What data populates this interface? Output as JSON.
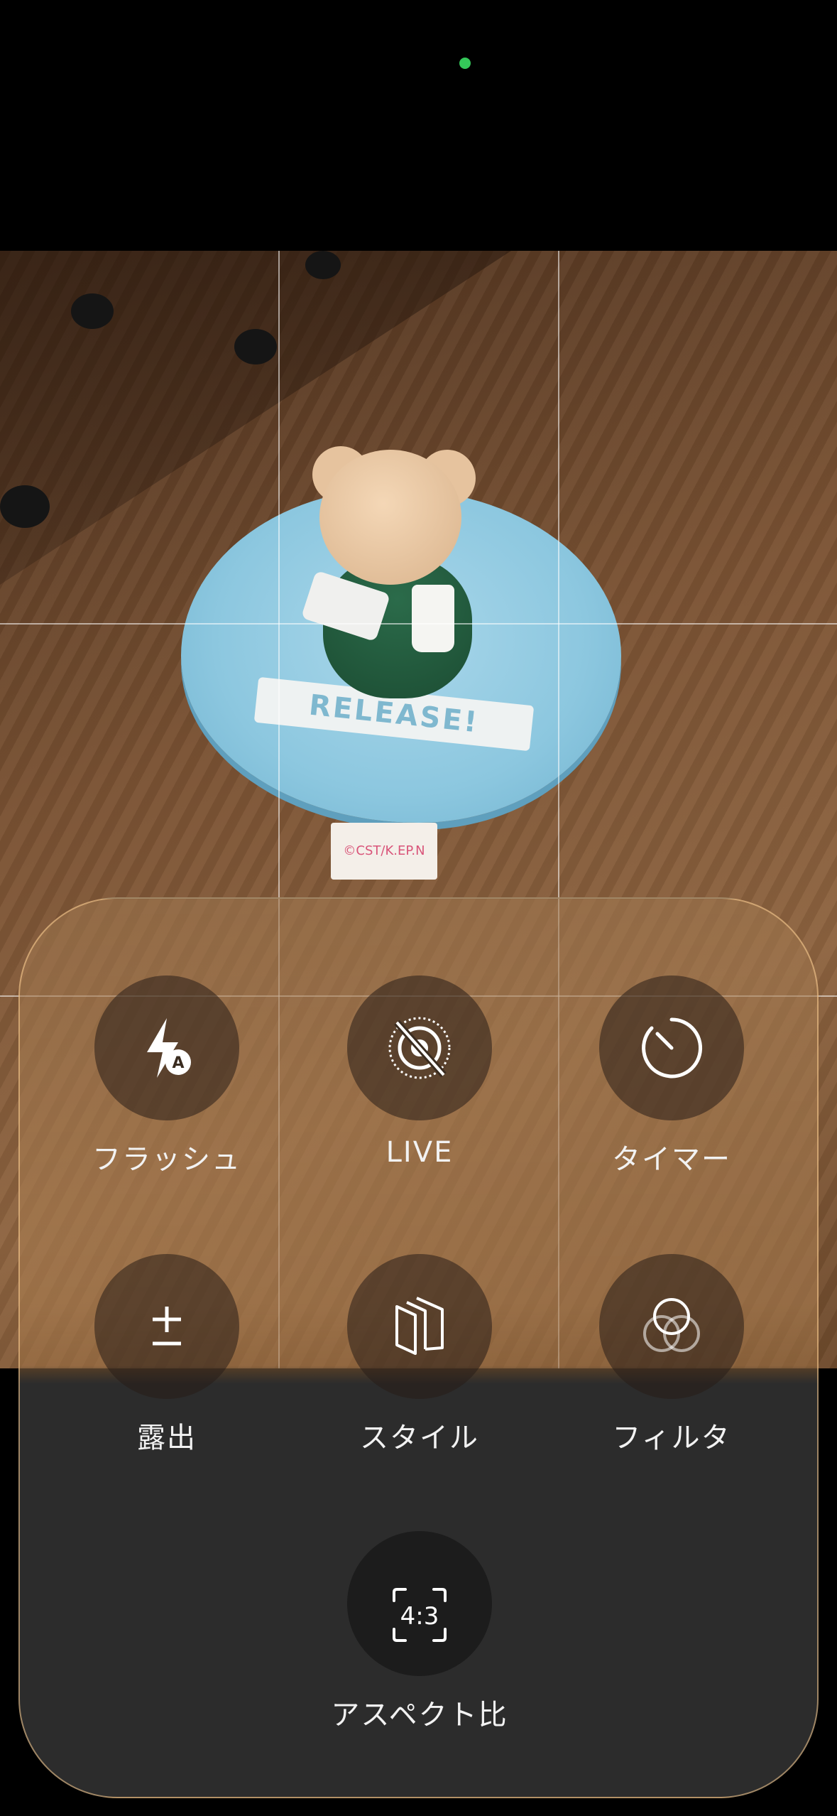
{
  "status": {
    "camera_indicator_color": "#34c759"
  },
  "controls": [
    {
      "id": "flash",
      "label": "フラッシュ",
      "icon": "flash-auto-icon"
    },
    {
      "id": "live",
      "label": "LIVE",
      "icon": "live-off-icon"
    },
    {
      "id": "timer",
      "label": "タイマー",
      "icon": "timer-icon"
    },
    {
      "id": "exposure",
      "label": "露出",
      "icon": "exposure-icon"
    },
    {
      "id": "style",
      "label": "スタイル",
      "icon": "styles-icon"
    },
    {
      "id": "filter",
      "label": "フィルタ",
      "icon": "filters-icon"
    },
    {
      "id": "aspect",
      "label": "アスペクト比",
      "icon": "aspect-ratio-icon",
      "value": "4:3"
    }
  ],
  "viewfinder": {
    "banner_text": "RELEASE!",
    "tag_text": "©CST/K.EP.N"
  }
}
